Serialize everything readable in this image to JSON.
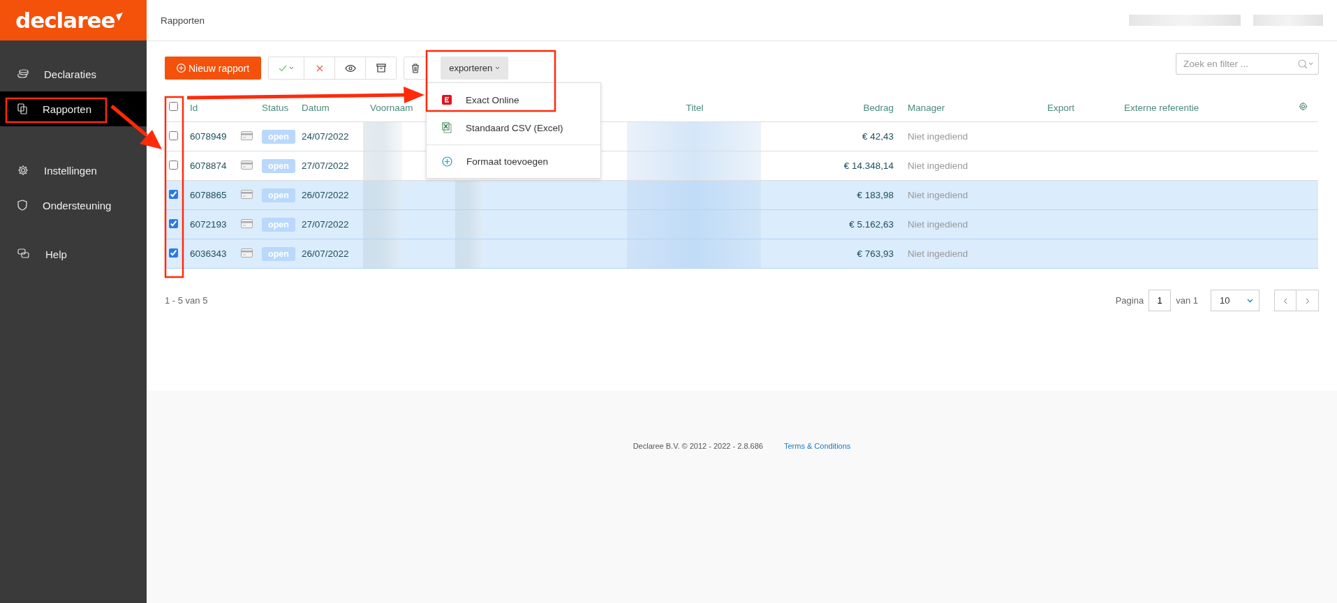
{
  "brand": {
    "logo": "declaree"
  },
  "sidebar": {
    "items": [
      {
        "label": "Declaraties",
        "kind": "coins",
        "selected": false
      },
      {
        "label": "Rapporten",
        "kind": "copy",
        "selected": true
      },
      {
        "label": "Instellingen",
        "kind": "gear",
        "selected": false
      },
      {
        "label": "Ondersteuning",
        "kind": "shield",
        "selected": false
      },
      {
        "label": "Help",
        "kind": "chat",
        "selected": false
      }
    ]
  },
  "header": {
    "title": "Rapporten"
  },
  "toolbar": {
    "new_button": "Nieuw rapport",
    "export_button": "exporteren",
    "search": {
      "placeholder": "Zoek en filter ..."
    }
  },
  "export_menu": {
    "items": [
      {
        "label": "Exact Online",
        "kind": "exact"
      },
      {
        "label": "Standaard CSV (Excel)",
        "kind": "excel"
      },
      {
        "label": "Formaat toevoegen",
        "kind": "add"
      }
    ]
  },
  "table": {
    "select_all_checked": false,
    "columns": [
      "Id",
      "Status",
      "Datum",
      "Voornaam",
      "Titel",
      "Bedrag",
      "Manager",
      "Export",
      "Externe referentie"
    ],
    "rows": [
      {
        "selected": false,
        "id": "6078949",
        "status": "open",
        "date": "24/07/2022",
        "amount": "€ 42,43",
        "manager": "Niet ingediend"
      },
      {
        "selected": false,
        "id": "6078874",
        "status": "open",
        "date": "27/07/2022",
        "amount": "€ 14.348,14",
        "manager": "Niet ingediend"
      },
      {
        "selected": true,
        "id": "6078865",
        "status": "open",
        "date": "26/07/2022",
        "amount": "€ 183,98",
        "manager": "Niet ingediend"
      },
      {
        "selected": true,
        "id": "6072193",
        "status": "open",
        "date": "27/07/2022",
        "amount": "€ 5.162,63",
        "manager": "Niet ingediend"
      },
      {
        "selected": true,
        "id": "6036343",
        "status": "open",
        "date": "26/07/2022",
        "amount": "€ 763,93",
        "manager": "Niet ingediend"
      }
    ]
  },
  "pagination": {
    "range": "1 - 5 van 5",
    "page_label": "Pagina",
    "page": "1",
    "of_label": "van 1",
    "page_size": "10"
  },
  "footer": {
    "copyright": "Declaree B.V. © 2012 - 2022 - 2.8.686",
    "link": "Terms & Conditions"
  }
}
